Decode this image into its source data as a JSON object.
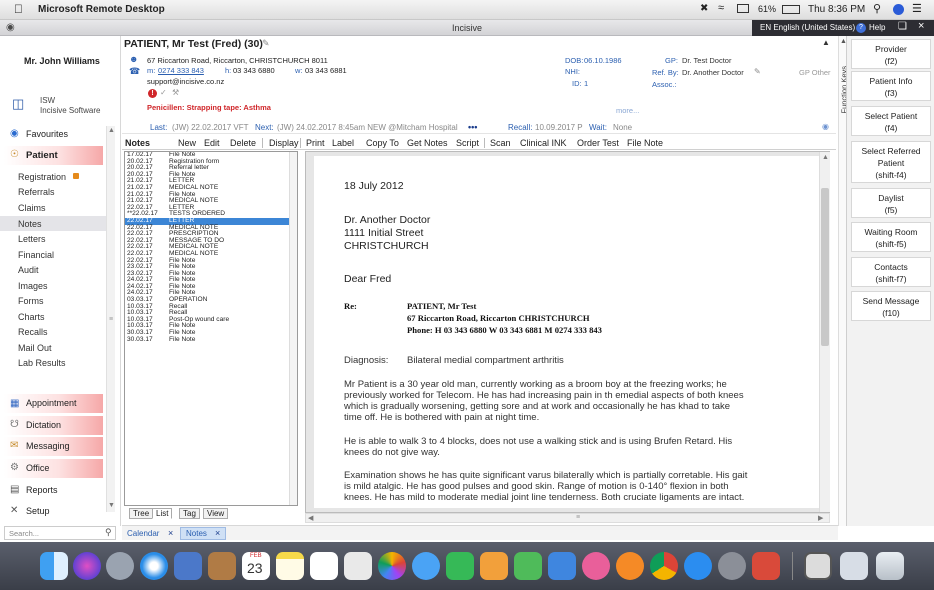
{
  "menubar": {
    "app": "Microsoft Remote Desktop",
    "battery": "61%",
    "time": "Thu 8:36 PM"
  },
  "window": {
    "title": "Incisive",
    "language": "EN English (United States)",
    "help": "Help"
  },
  "user": {
    "name": "Mr. John Williams",
    "org_line1": "ISW",
    "org_line2": "Incisive Software"
  },
  "patient": {
    "header": "PATIENT, Mr Test (Fred) (30)",
    "address": "67 Riccarton Road, Riccarton, CHRISTCHURCH 8011",
    "mobile_label": "m:",
    "mobile": "0274 333 843",
    "home_label": "h:",
    "home": "03 343 6880",
    "work_label": "w:",
    "work": "03 343 6881",
    "email": "support@incisive.co.nz",
    "alert": "Penicillen: Strapping tape: Asthma",
    "dob_label": "DOB:",
    "dob": "06.10.1986",
    "nhi_label": "NHI:",
    "id_label": "ID:",
    "id": "1",
    "gp_label": "GP:",
    "gp": "Dr. Test Doctor",
    "refby_label": "Ref. By:",
    "refby": "Dr. Another Doctor",
    "assoc_label": "Assoc.:",
    "gp_other": "GP Other",
    "more": "more..."
  },
  "visits": {
    "last_label": "Last:",
    "last": "(JW) 22.02.2017 VFT",
    "next_label": "Next:",
    "next": "(JW) 24.02.2017 8:45am NEW @Mitcham Hospital",
    "dots": "•••",
    "recall_label": "Recall:",
    "recall": "10.09.2017 P",
    "wait_label": "Wait:",
    "wait": "None"
  },
  "sidebar": {
    "favourites": "Favourites",
    "patient": "Patient",
    "items": [
      "Registration",
      "Referrals",
      "Claims",
      "Notes",
      "Letters",
      "Financial",
      "Audit",
      "Images",
      "Forms",
      "Charts",
      "Recalls",
      "Mail Out",
      "Lab Results"
    ],
    "sections": [
      "Appointment",
      "Dictation",
      "Messaging",
      "Office",
      "Reports",
      "Setup"
    ],
    "search_placeholder": "Search..."
  },
  "notes_toolbar": {
    "title": "Notes",
    "buttons": [
      "New",
      "Edit",
      "Delete",
      "Display",
      "Print",
      "Label",
      "Copy To",
      "Get Notes",
      "Script",
      "Scan",
      "Clinical INK",
      "Order Test",
      "File Note"
    ]
  },
  "notes": [
    [
      "17.02.17",
      "File Note"
    ],
    [
      "20.02.17",
      "Registration form"
    ],
    [
      "20.02.17",
      "Referral letter"
    ],
    [
      "20.02.17",
      "File Note"
    ],
    [
      "21.02.17",
      "LETTER"
    ],
    [
      "21.02.17",
      "MEDICAL NOTE"
    ],
    [
      "21.02.17",
      "File Note"
    ],
    [
      "21.02.17",
      "MEDICAL NOTE"
    ],
    [
      "22.02.17",
      "LETTER"
    ],
    [
      "**22.02.17",
      "TESTS ORDERED"
    ],
    [
      "22.02.17",
      "LETTER"
    ],
    [
      "22.02.17",
      "MEDICAL NOTE"
    ],
    [
      "22.02.17",
      "PRESCRIPTION"
    ],
    [
      "22.02.17",
      "MESSAGE TO DO"
    ],
    [
      "22.02.17",
      "MEDICAL NOTE"
    ],
    [
      "22.02.17",
      "MEDICAL NOTE"
    ],
    [
      "22.02.17",
      "File Note"
    ],
    [
      "23.02.17",
      "File Note"
    ],
    [
      "23.02.17",
      "File Note"
    ],
    [
      "24.02.17",
      "File Note"
    ],
    [
      "24.02.17",
      "File Note"
    ],
    [
      "24.02.17",
      "File Note"
    ],
    [
      "03.03.17",
      "OPERATION"
    ],
    [
      "10.03.17",
      "Recall"
    ],
    [
      "10.03.17",
      "Recall"
    ],
    [
      "10.03.17",
      "Post-Op wound care"
    ],
    [
      "10.03.17",
      "File Note"
    ],
    [
      "30.03.17",
      "File Note"
    ],
    [
      "30.03.17",
      "File Note"
    ]
  ],
  "selected_note_index": 10,
  "view_tabs": [
    "Tree",
    "List",
    "Tag",
    "View"
  ],
  "bottom_tabs": [
    "Calendar",
    "Notes"
  ],
  "letter": {
    "date": "18 July 2012",
    "recipient": [
      "Dr. Another Doctor",
      "1111 Initial Street",
      "CHRISTCHURCH"
    ],
    "salutation": "Dear Fred",
    "re_label": "Re:",
    "re_lines": [
      "PATIENT, Mr Test",
      "67 Riccarton Road, Riccarton CHRISTCHURCH",
      "Phone: H 03 343 6880 W 03 343 6881 M 0274 333 843"
    ],
    "diag_label": "Diagnosis:",
    "diag": "Bilateral medial compartment arthritis",
    "p1": "Mr Patient is a 30 year old man, currently working as a broom  boy at the freezing works; he previously worked for Telecom.  He has had increasing pain in th emedial aspects of both knees which is gradually worsening, getting sore and at work and occasionally he has khad to take time off.  He is bothered with pain at night time.",
    "p2": "He is able to walk 3 to 4 blocks, does not use a walking stick and is using Brufen Retard.  His knees do not give way.",
    "p3": "Examination shows he has quite significant varus bilaterally which is partially corretable. His gait is mild atalgic.  He has good pulses and good skin.  Range of motion is 0-140° flexion in both knees.  He has mild to moderate medial joint line tenderness. Both cruciate ligaments are intact."
  },
  "function_keys_label": "Function Keys",
  "right_buttons": [
    [
      "Provider",
      "(f2)"
    ],
    [
      "Patient Info",
      "(f3)"
    ],
    [
      "Select Patient",
      "(f4)"
    ],
    [
      "Select Referred Patient",
      "(shift-f4)"
    ],
    [
      "Daylist",
      "(f5)"
    ],
    [
      "Waiting Room",
      "(shift-f5)"
    ],
    [
      "Contacts",
      "(shift-f7)"
    ],
    [
      "Send Message",
      "(f10)"
    ]
  ],
  "dock": {
    "calendar_day": "23",
    "calendar_month": "FEB"
  },
  "colors": {
    "accent": "#1a3c8c",
    "selection": "#3c86d6",
    "alert": "#d0262a",
    "pink": "#f6a8a8"
  }
}
